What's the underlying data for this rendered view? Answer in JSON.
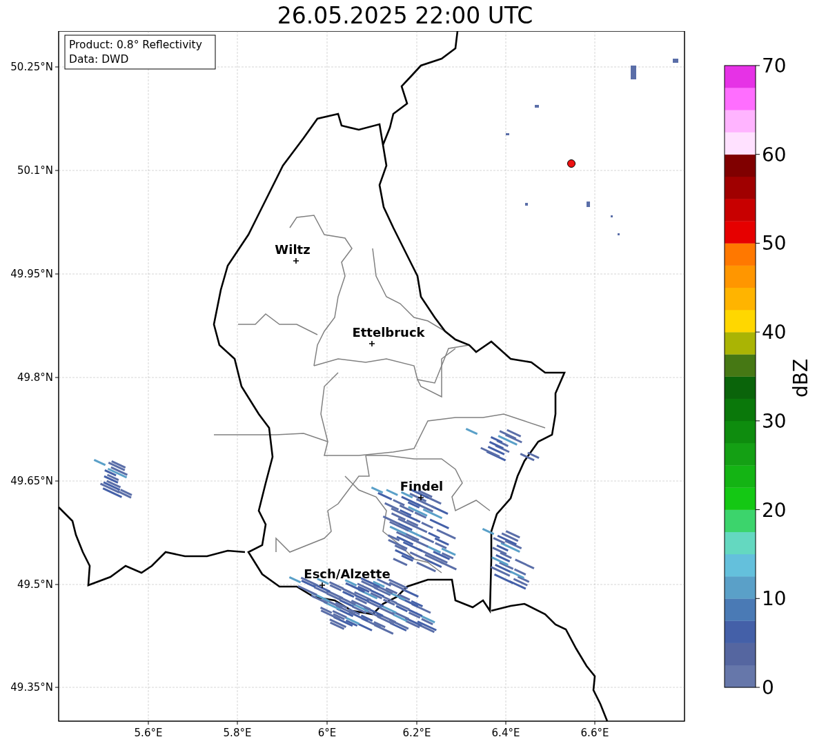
{
  "title": "26.05.2025 22:00 UTC",
  "info_box": {
    "lines": [
      "Product: 0.8° Reflectivity",
      "Data: DWD"
    ]
  },
  "y_ticks": [
    "50.25°N",
    "50.1°N",
    "49.95°N",
    "49.8°N",
    "49.65°N",
    "49.5°N",
    "49.35°N"
  ],
  "x_ticks": [
    "5.6°E",
    "5.8°E",
    "6°E",
    "6.2°E",
    "6.4°E",
    "6.6°E"
  ],
  "cities": [
    {
      "name": "Wiltz"
    },
    {
      "name": "Ettelbruck"
    },
    {
      "name": "Findel"
    },
    {
      "name": "Esch/Alzette"
    }
  ],
  "colorbar": {
    "label": "dBZ",
    "ticks": [
      "70",
      "60",
      "50",
      "40",
      "30",
      "20",
      "10",
      "0"
    ],
    "segments": [
      {
        "color": "#6677aa"
      },
      {
        "color": "#5566a0"
      },
      {
        "color": "#4460a8"
      },
      {
        "color": "#4a7ab5"
      },
      {
        "color": "#5aa0c8"
      },
      {
        "color": "#64c0dc"
      },
      {
        "color": "#64d8c0"
      },
      {
        "color": "#3cd46c"
      },
      {
        "color": "#14c814"
      },
      {
        "color": "#14b414"
      },
      {
        "color": "#14a014"
      },
      {
        "color": "#0e8c0e"
      },
      {
        "color": "#0a780a"
      },
      {
        "color": "#0a640a"
      },
      {
        "color": "#467814"
      },
      {
        "color": "#aab404"
      },
      {
        "color": "#ffd700"
      },
      {
        "color": "#ffb400"
      },
      {
        "color": "#ff9600"
      },
      {
        "color": "#ff7800"
      },
      {
        "color": "#e60000"
      },
      {
        "color": "#c80000"
      },
      {
        "color": "#a00000"
      },
      {
        "color": "#800000"
      },
      {
        "color": "#ffe1ff"
      },
      {
        "color": "#ffb4ff"
      },
      {
        "color": "#ff6eff"
      },
      {
        "color": "#e632e6"
      }
    ]
  }
}
